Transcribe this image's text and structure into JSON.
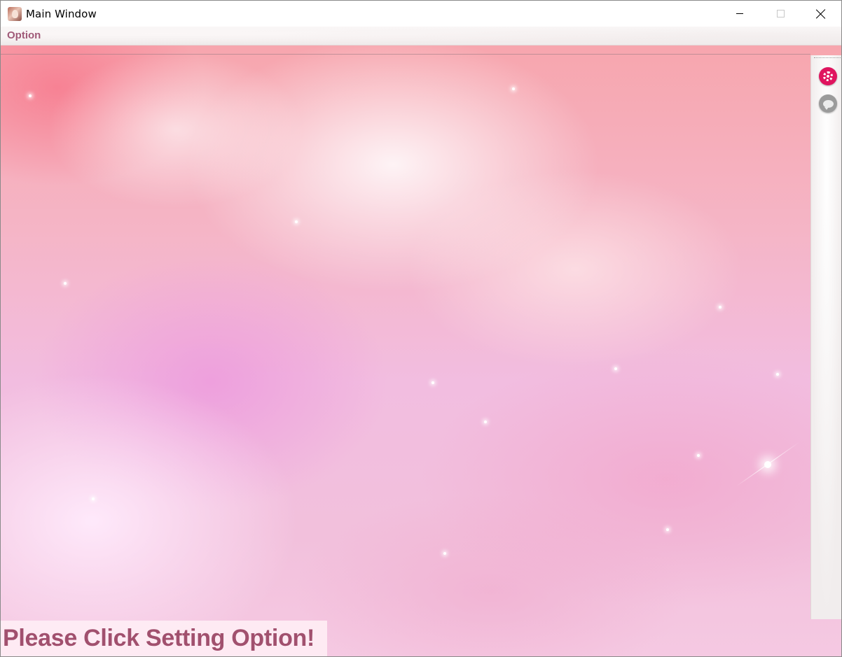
{
  "window": {
    "title": "Main Window"
  },
  "menubar": {
    "items": [
      {
        "label": "Option"
      }
    ]
  },
  "sidebar": {
    "buttons": [
      {
        "icon": "gear-icon",
        "color": "#e0145f"
      },
      {
        "icon": "chat-bubble-icon",
        "color": "#9b9b9b"
      }
    ]
  },
  "status": {
    "message": "Please Click Setting Option!",
    "color": "#a1506e"
  }
}
